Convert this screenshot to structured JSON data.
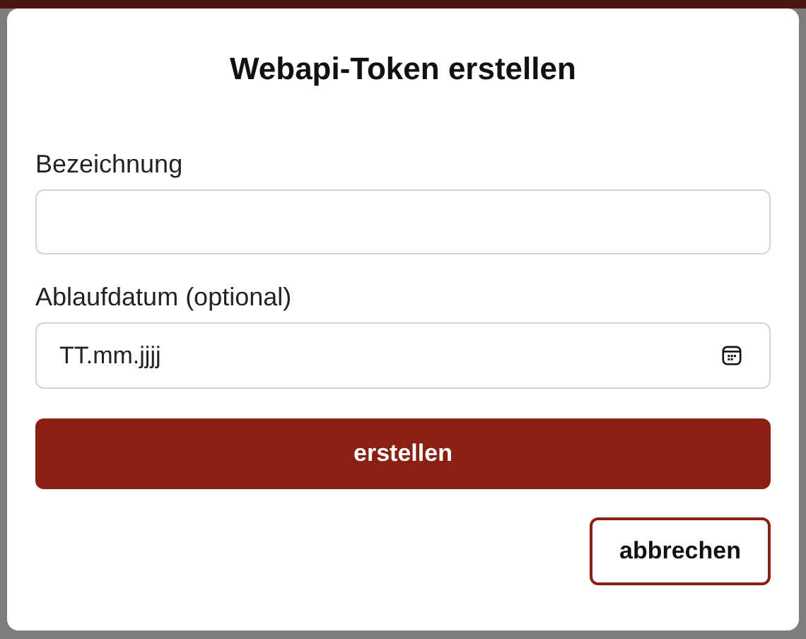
{
  "dialog": {
    "title": "Webapi-Token erstellen",
    "fields": [
      {
        "kind": "text",
        "label": "Bezeichnung"
      },
      {
        "kind": "date",
        "label": "Ablaufdatum (optional)",
        "placeholder": "TT.mm.jjjj"
      }
    ],
    "primary_button": "erstellen",
    "cancel_button": "abbrechen"
  }
}
